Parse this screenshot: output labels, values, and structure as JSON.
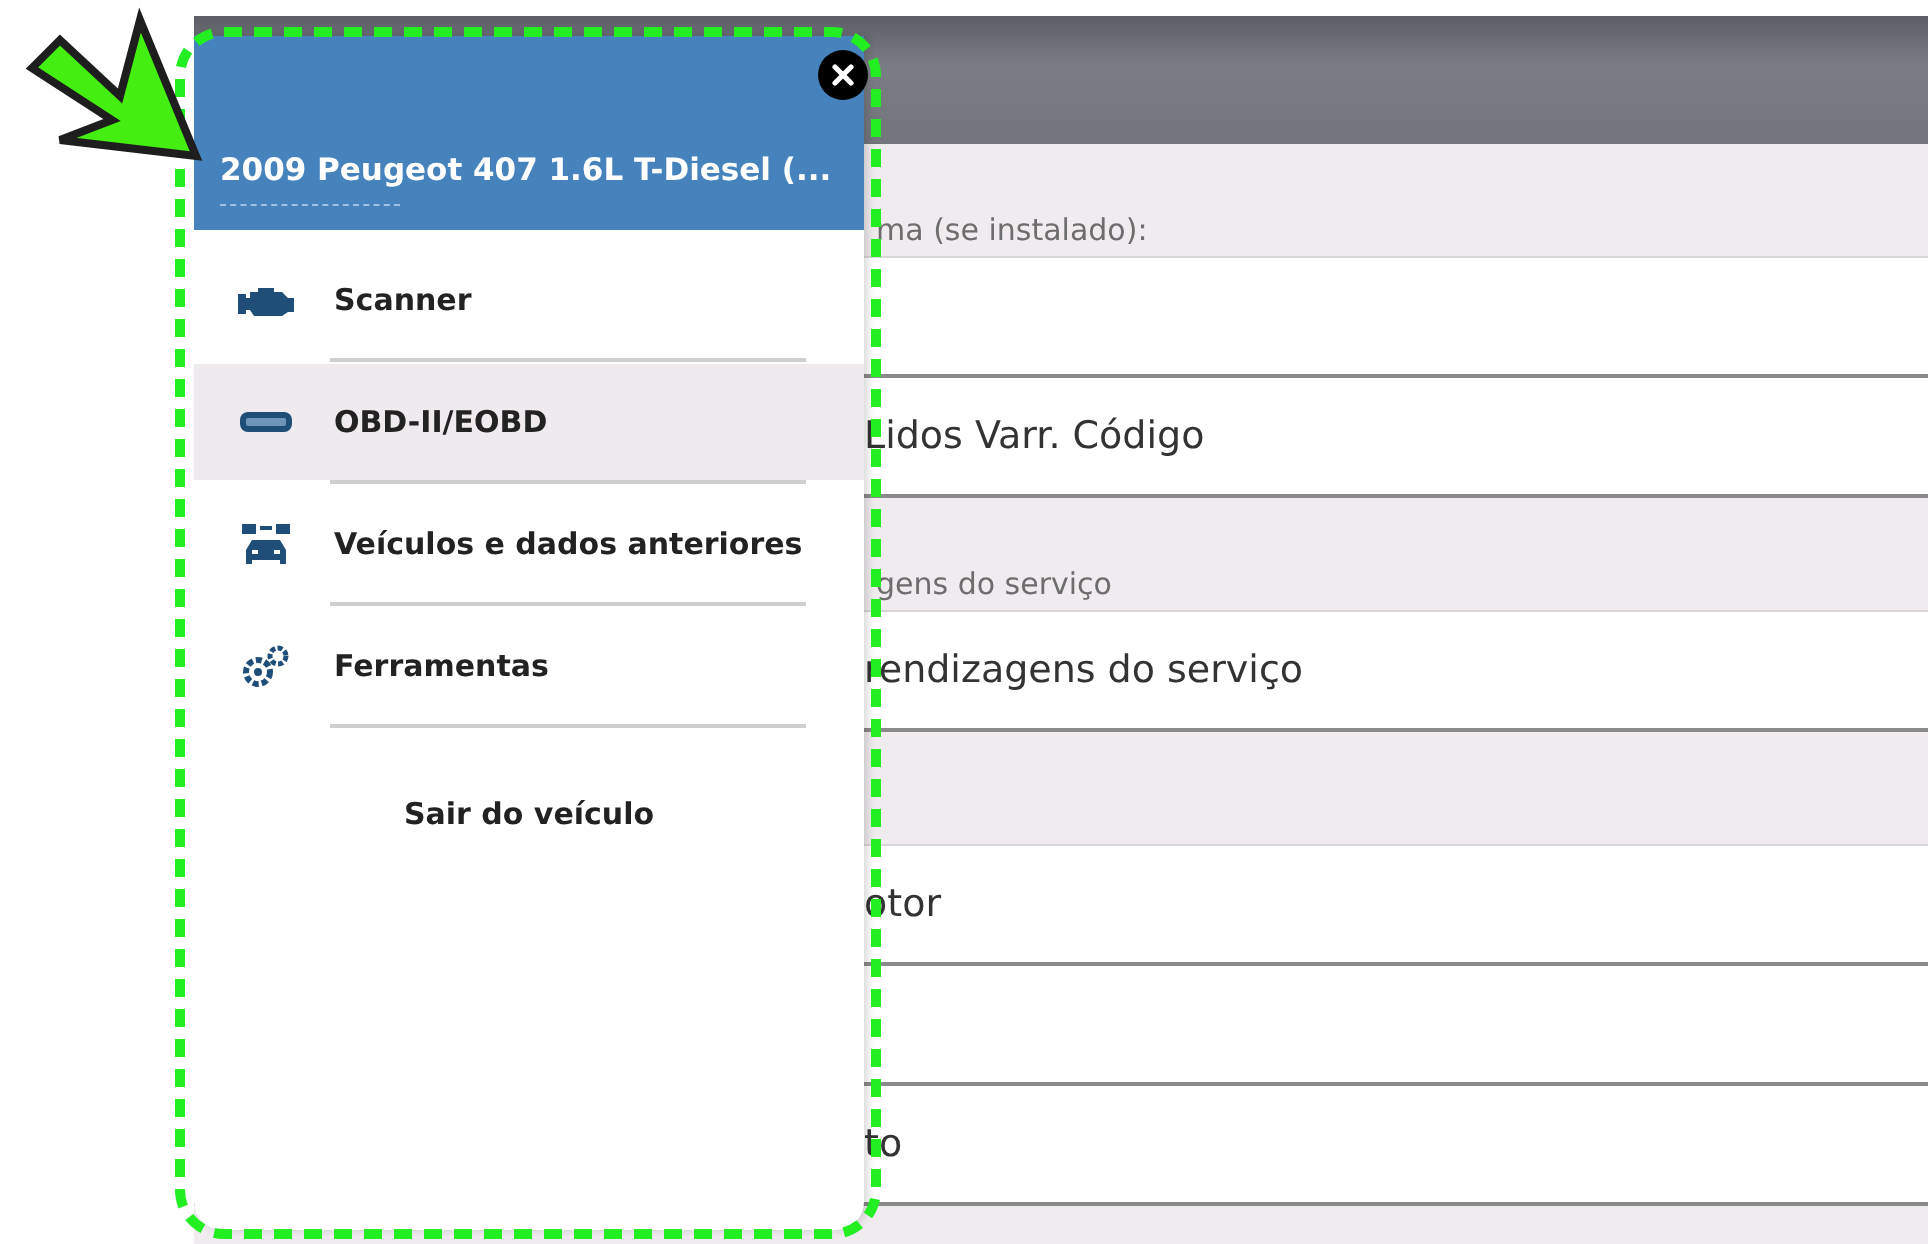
{
  "background_list": {
    "rows": [
      {
        "kind": "section",
        "text": "ma (se instalado):"
      },
      {
        "kind": "item"
      },
      {
        "kind": "item",
        "text": "Lidos Varr. Código"
      },
      {
        "kind": "section",
        "text": "gens do serviço"
      },
      {
        "kind": "item",
        "text": "rendizagens do serviço"
      },
      {
        "kind": "section"
      },
      {
        "kind": "item",
        "text": "otor"
      },
      {
        "kind": "item"
      },
      {
        "kind": "item",
        "text": "to"
      }
    ]
  },
  "drawer": {
    "title": "2009 Peugeot 407 1.6L T-Diesel (...",
    "items": [
      {
        "kind": "engine",
        "label": "Scanner",
        "selected": false
      },
      {
        "kind": "connector",
        "label": "OBD-II/EOBD",
        "selected": true
      },
      {
        "kind": "cars",
        "label": "Veículos e dados anteriores",
        "selected": false
      },
      {
        "kind": "gears",
        "label": "Ferramentas",
        "selected": false
      }
    ],
    "exit_label": "Sair do veículo"
  }
}
